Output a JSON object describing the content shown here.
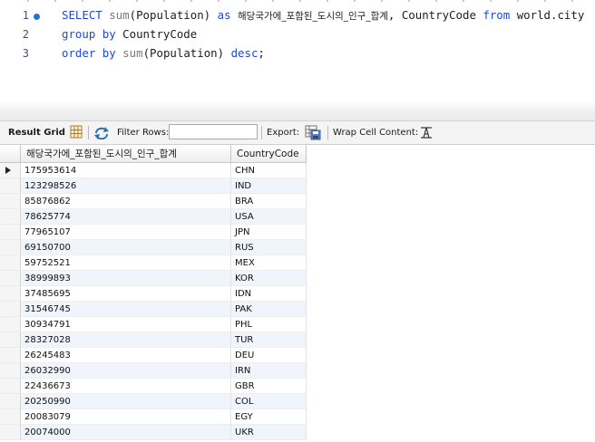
{
  "editor": {
    "lines": [
      {
        "num": "1",
        "active": true
      },
      {
        "num": "2",
        "active": false
      },
      {
        "num": "3",
        "active": false
      }
    ],
    "tokens": {
      "select": "SELECT",
      "sum": "sum",
      "population_arg": "(Population)",
      "as": "as",
      "alias": "해당국가에_포함된_도시의_인구_합계",
      "comma_country": ", CountryCode",
      "from": "from",
      "table": "world.city",
      "group": "group",
      "by1": "by",
      "group_col": "CountryCode",
      "order": "order",
      "by2": "by",
      "sum2": "sum",
      "order_arg": "(Population)",
      "desc": "desc",
      "semicolon": ";"
    }
  },
  "toolbar": {
    "result_grid": "Result Grid",
    "filter_rows": "Filter Rows:",
    "filter_value": "",
    "export": "Export:",
    "wrap": "Wrap Cell Content:"
  },
  "grid": {
    "columns": [
      "해당국가에_포함된_도시의_인구_합계",
      "CountryCode"
    ],
    "rows": [
      [
        "175953614",
        "CHN"
      ],
      [
        "123298526",
        "IND"
      ],
      [
        "85876862",
        "BRA"
      ],
      [
        "78625774",
        "USA"
      ],
      [
        "77965107",
        "JPN"
      ],
      [
        "69150700",
        "RUS"
      ],
      [
        "59752521",
        "MEX"
      ],
      [
        "38999893",
        "KOR"
      ],
      [
        "37485695",
        "IDN"
      ],
      [
        "31546745",
        "PAK"
      ],
      [
        "30934791",
        "PHL"
      ],
      [
        "28327028",
        "TUR"
      ],
      [
        "26245483",
        "DEU"
      ],
      [
        "26032990",
        "IRN"
      ],
      [
        "22436673",
        "GBR"
      ],
      [
        "20250990",
        "COL"
      ],
      [
        "20083079",
        "EGY"
      ],
      [
        "20074000",
        "UKR"
      ]
    ]
  },
  "colors": {
    "keyword": "#1f47d8",
    "function": "#7a7a7a",
    "alt_row": "#f0f5fc",
    "active_dot": "#2a6fd6"
  }
}
